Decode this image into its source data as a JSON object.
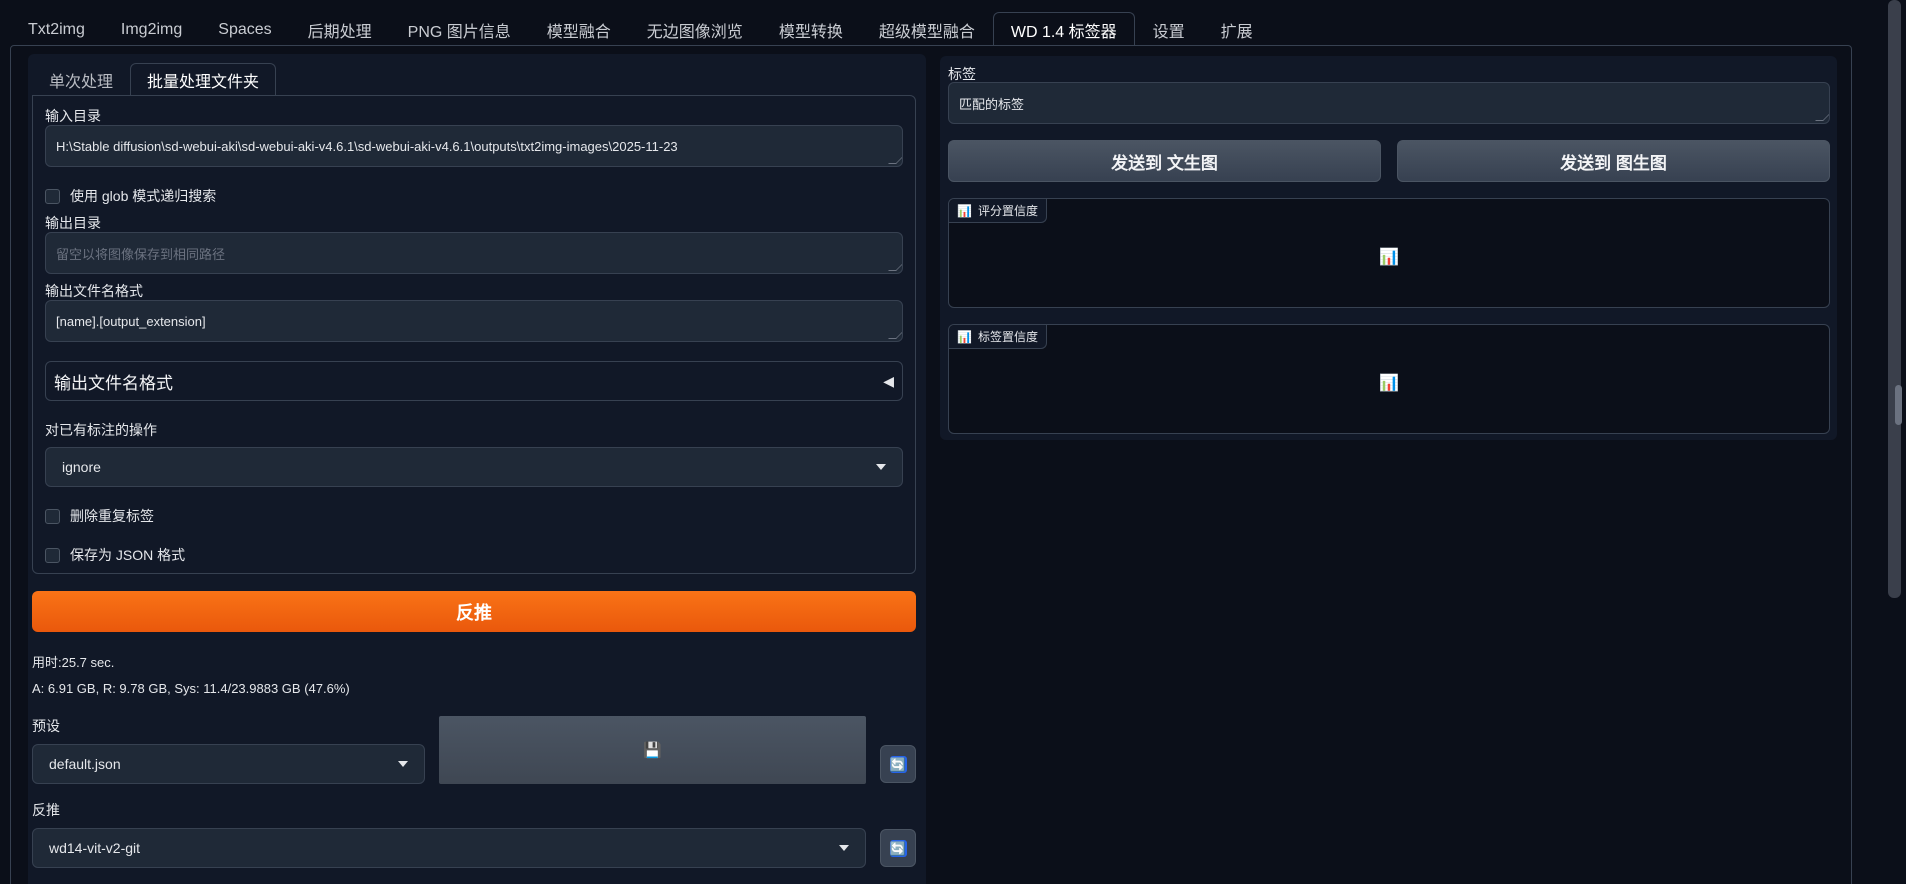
{
  "top_tabs": [
    "Txt2img",
    "Img2img",
    "Spaces",
    "后期处理",
    "PNG 图片信息",
    "模型融合",
    "无边图像浏览",
    "模型转换",
    "超级模型融合",
    "WD 1.4 标签器",
    "设置",
    "扩展"
  ],
  "active_top_tab": "WD 1.4 标签器",
  "sub_tabs": [
    "单次处理",
    "批量处理文件夹"
  ],
  "active_sub_tab": "批量处理文件夹",
  "batch": {
    "input_dir_label": "输入目录",
    "input_dir_value": "H:\\Stable diffusion\\sd-webui-aki\\sd-webui-aki-v4.6.1\\sd-webui-aki-v4.6.1\\outputs\\txt2img-images\\2025-11-23",
    "glob_label": "使用 glob 模式递归搜索",
    "output_dir_label": "输出目录",
    "output_dir_placeholder": "留空以将图像保存到相同路径",
    "filename_format_label": "输出文件名格式",
    "filename_format_value": "[name].[output_extension]",
    "accordion_title": "输出文件名格式",
    "existing_action_label": "对已有标注的操作",
    "existing_action_value": "ignore",
    "remove_duplicates_label": "删除重复标签",
    "save_json_label": "保存为 JSON 格式"
  },
  "interrogate_button": "反推",
  "info": {
    "time": "用时:25.7 sec.",
    "mem": "A: 6.91 GB, R: 9.78 GB, Sys: 11.4/23.9883 GB (47.6%)"
  },
  "preset": {
    "label": "预设",
    "value": "default.json"
  },
  "interrogator": {
    "label": "反推",
    "value": "wd14-vit-v2-git"
  },
  "right": {
    "tags_label": "标签",
    "tags_value": "匹配的标签",
    "send_txt2img": "发送到 文生图",
    "send_img2img": "发送到 图生图",
    "rating_label": "评分置信度",
    "tag_conf_label": "标签置信度"
  },
  "icons": {
    "save": "💾",
    "refresh": "🔄",
    "chart": "📊"
  }
}
